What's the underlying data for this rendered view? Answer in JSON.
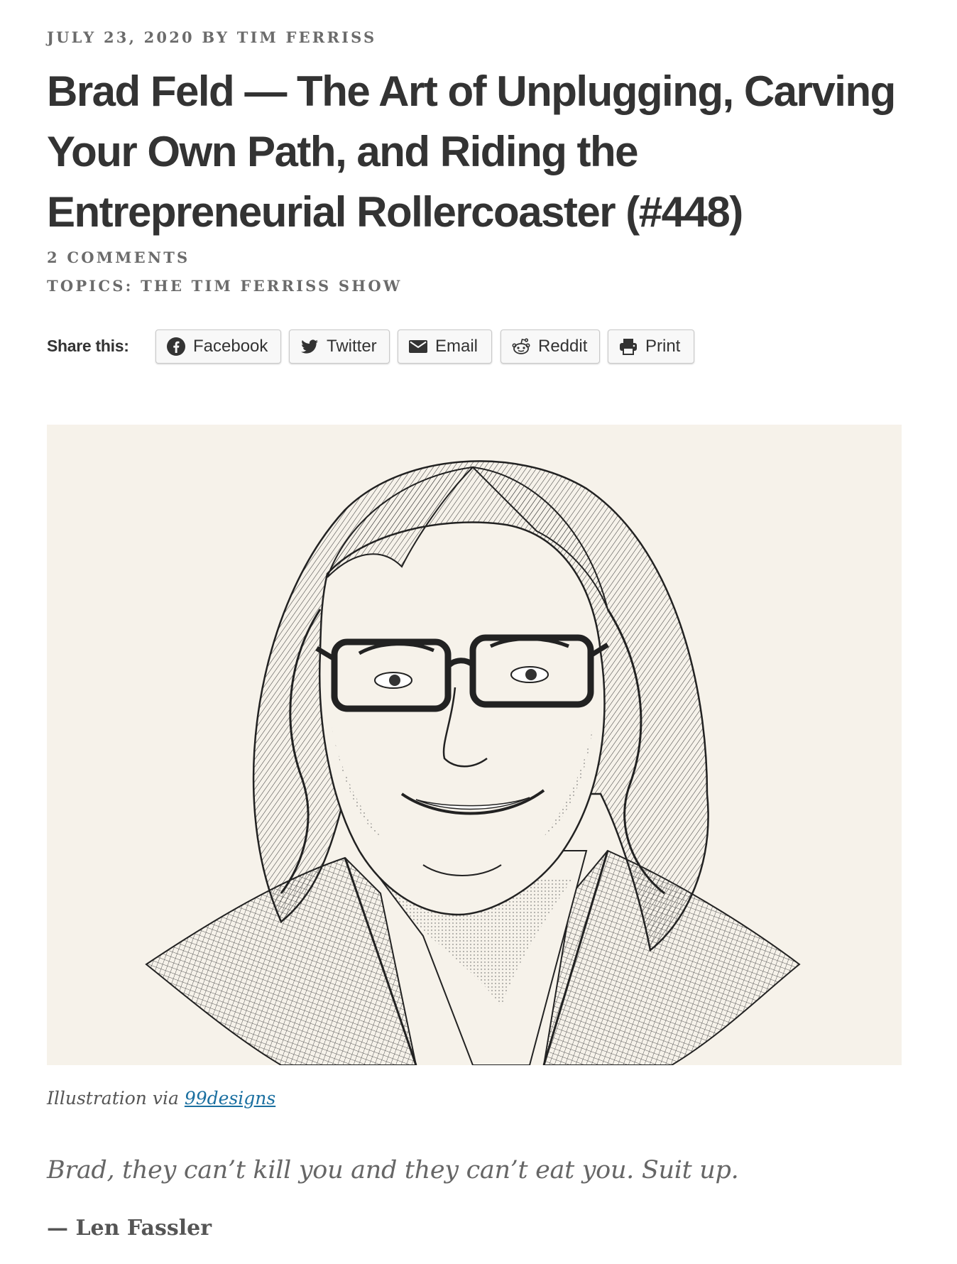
{
  "post": {
    "date": "JULY 23, 2020",
    "by": "BY",
    "author": "TIM FERRISS",
    "title": "Brad Feld — The Art of Unplugging, Carving Your Own Path, and Riding the Entrepreneurial Rollercoaster (#448)",
    "comments": "2 COMMENTS",
    "topics_label": "TOPICS:",
    "topic": "THE TIM FERRISS SHOW"
  },
  "share": {
    "label": "Share this:",
    "buttons": [
      {
        "label": "Facebook",
        "icon": "facebook-icon"
      },
      {
        "label": "Twitter",
        "icon": "twitter-icon"
      },
      {
        "label": "Email",
        "icon": "email-icon"
      },
      {
        "label": "Reddit",
        "icon": "reddit-icon"
      },
      {
        "label": "Print",
        "icon": "print-icon"
      }
    ]
  },
  "figure": {
    "background": "#f6f2ea",
    "caption_prefix": "Illustration via",
    "caption_link": "99designs"
  },
  "epigraph": {
    "quote": "Brad, they can’t kill you and they can’t eat you. Suit up.",
    "attribution": "— Len Fassler"
  },
  "colors": {
    "text": "#333333",
    "meta": "#6b6b6b",
    "link": "#1a6fa0"
  }
}
